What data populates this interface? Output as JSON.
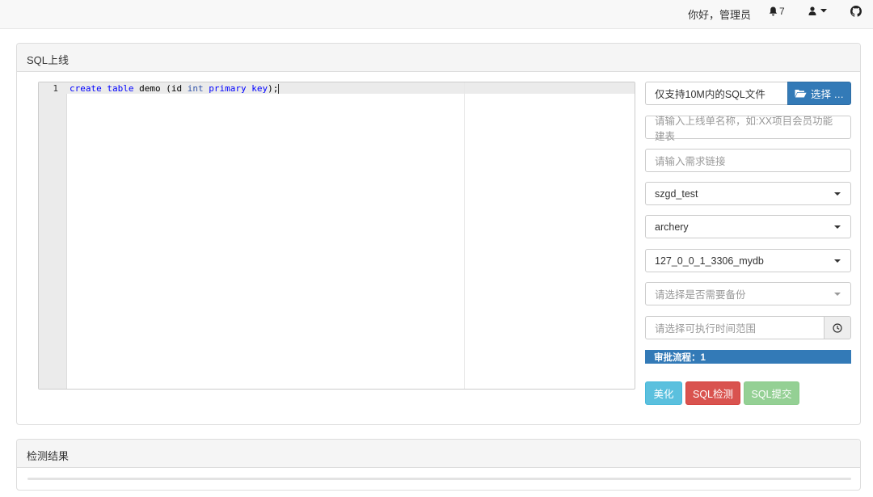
{
  "navbar": {
    "greeting": "你好，管理员",
    "notifications_count": "7"
  },
  "sql_panel": {
    "title": "SQL上线",
    "editor": {
      "line_number": "1",
      "code_tokens": [
        {
          "text": "create",
          "kind": "kw"
        },
        {
          "text": " ",
          "kind": "plain"
        },
        {
          "text": "table",
          "kind": "kw"
        },
        {
          "text": " demo (id ",
          "kind": "plain"
        },
        {
          "text": "int",
          "kind": "ty"
        },
        {
          "text": " ",
          "kind": "plain"
        },
        {
          "text": "primary",
          "kind": "kw"
        },
        {
          "text": " ",
          "kind": "plain"
        },
        {
          "text": "key",
          "kind": "kw"
        },
        {
          "text": ");",
          "kind": "plain"
        }
      ]
    },
    "form": {
      "file_hint": "仅支持10M内的SQL文件",
      "file_button": "选择 …",
      "workorder_name_placeholder": "请输入上线单名称，如:XX项目会员功能建表",
      "demand_url_placeholder": "请输入需求链接",
      "group_value": "szgd_test",
      "instance_value": "archery",
      "db_value": "127_0_0_1_3306_mydb",
      "backup_placeholder": "请选择是否需要备份",
      "run_time_placeholder": "请选择可执行时间范围",
      "workflow_label": "审批流程：",
      "workflow_value": "1"
    },
    "buttons": {
      "beautify": "美化",
      "check": "SQL检测",
      "submit": "SQL提交"
    }
  },
  "result_panel": {
    "title": "检测结果"
  },
  "colors": {
    "primary": "#337ab7",
    "info": "#5bc0de",
    "danger": "#d9534f",
    "success": "#5cb85c"
  }
}
